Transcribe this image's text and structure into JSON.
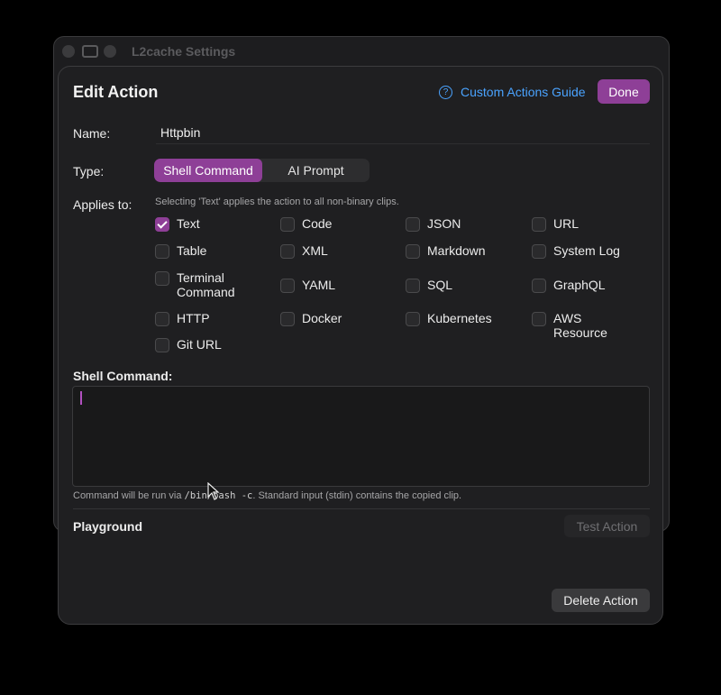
{
  "window": {
    "title": "L2cache Settings"
  },
  "sheet": {
    "title": "Edit Action",
    "guide_label": "Custom Actions Guide",
    "done_label": "Done",
    "name_label": "Name:",
    "name_value": "Httpbin",
    "type_label": "Type:",
    "type_options": [
      "Shell Command",
      "AI Prompt"
    ],
    "type_selected": "Shell Command",
    "applies_label": "Applies to:",
    "applies_hint": "Selecting 'Text' applies the action to all non-binary clips.",
    "clip_types": [
      {
        "label": "Text",
        "checked": true
      },
      {
        "label": "Code",
        "checked": false
      },
      {
        "label": "JSON",
        "checked": false
      },
      {
        "label": "URL",
        "checked": false
      },
      {
        "label": "Table",
        "checked": false
      },
      {
        "label": "XML",
        "checked": false
      },
      {
        "label": "Markdown",
        "checked": false
      },
      {
        "label": "System Log",
        "checked": false
      },
      {
        "label": "Terminal\nCommand",
        "checked": false
      },
      {
        "label": "YAML",
        "checked": false
      },
      {
        "label": "SQL",
        "checked": false
      },
      {
        "label": "GraphQL",
        "checked": false
      },
      {
        "label": "HTTP",
        "checked": false
      },
      {
        "label": "Docker",
        "checked": false
      },
      {
        "label": "Kubernetes",
        "checked": false
      },
      {
        "label": "AWS Resource",
        "checked": false
      },
      {
        "label": "Git URL",
        "checked": false
      }
    ],
    "command_section_title": "Shell Command:",
    "command_value": "",
    "footnote_prefix": "Command will be run via ",
    "footnote_code": "/bin/bash -c",
    "footnote_suffix": ". Standard input (stdin) contains the copied clip.",
    "playground_title": "Playground",
    "test_label": "Test Action",
    "delete_label": "Delete Action"
  },
  "colors": {
    "accent": "#8e3f97",
    "link": "#4aa3ff",
    "background": "#1f1f21"
  }
}
